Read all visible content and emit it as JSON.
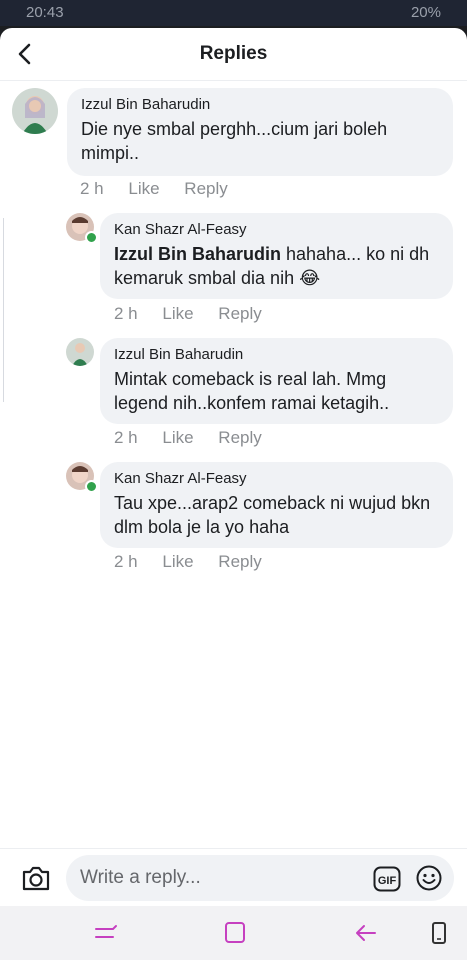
{
  "status_bar": {
    "time": "20:43",
    "battery": "20%"
  },
  "header": {
    "title": "Replies"
  },
  "comments": [
    {
      "author": "Izzul Bin Baharudin",
      "mention": "",
      "text": "Die nye smbal perghh...cium jari boleh mimpi..",
      "time": "2 h",
      "like": "Like",
      "reply": "Reply"
    },
    {
      "author": "Kan Shazr Al-Feasy",
      "mention": "Izzul Bin Baharudin",
      "text": " hahaha... ko ni dh kemaruk smbal dia nih 😂",
      "time": "2 h",
      "like": "Like",
      "reply": "Reply"
    },
    {
      "author": "Izzul Bin Baharudin",
      "mention": "",
      "text": "Mintak comeback is real lah. Mmg legend nih..konfem ramai ketagih..",
      "time": "2 h",
      "like": "Like",
      "reply": "Reply"
    },
    {
      "author": "Kan Shazr Al-Feasy",
      "mention": "",
      "text": "Tau xpe...arap2 comeback ni wujud bkn dlm bola je la yo haha",
      "time": "2 h",
      "like": "Like",
      "reply": "Reply"
    }
  ],
  "composer": {
    "placeholder": "Write a reply...",
    "gif_label": "GIF"
  },
  "icons": {
    "back": "back-arrow-icon",
    "camera": "camera-icon",
    "gif": "gif-icon",
    "emoji": "emoji-icon",
    "nav_recents": "recents-icon",
    "nav_home": "home-icon",
    "nav_back": "nav-back-icon",
    "nav_keyboard": "phone-icon"
  },
  "colors": {
    "online": "#31a24c",
    "nav_icons": "#c640c0",
    "bubble": "#f0f2f5",
    "meta": "#8a8d91"
  }
}
